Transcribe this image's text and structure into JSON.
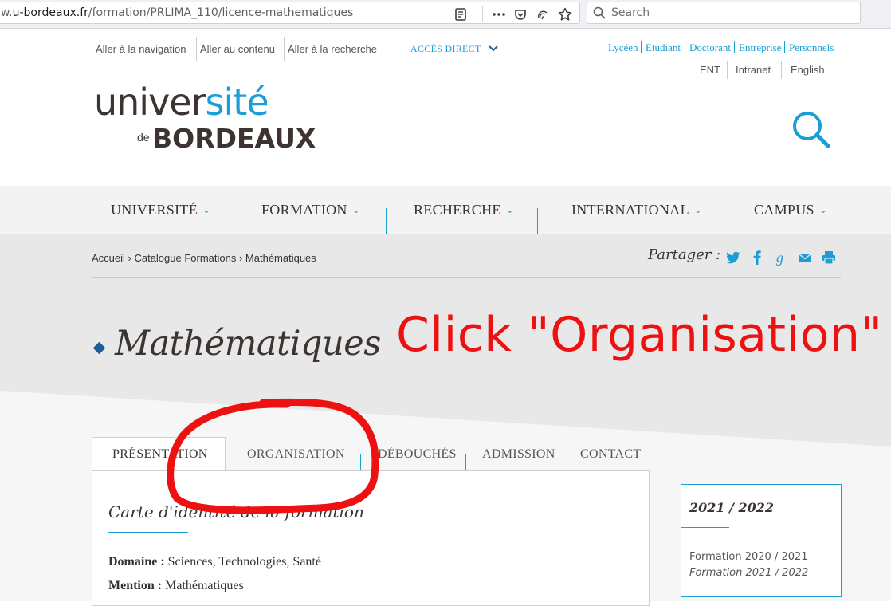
{
  "browser": {
    "url_prefix": "w.",
    "url_host": "u-bordeaux.fr",
    "url_path": "/formation/PRLIMA_110/licence-mathematiques",
    "search_placeholder": "Search"
  },
  "skiplinks": [
    "Aller à la navigation",
    "Aller au contenu",
    "Aller à la recherche"
  ],
  "acces_direct": "ACCÈS DIRECT",
  "personas": [
    "Lycéen",
    "Etudiant",
    "Doctorant",
    "Entreprise",
    "Personnels"
  ],
  "toolinks": [
    "ENT",
    "Intranet",
    "English"
  ],
  "logo": {
    "part1": "univer",
    "part2": "sité",
    "de": "de",
    "bordeaux": "BORDEAUX"
  },
  "nav": [
    "UNIVERSITÉ",
    "FORMATION",
    "RECHERCHE",
    "INTERNATIONAL",
    "CAMPUS"
  ],
  "breadcrumb": "Accueil › Catalogue Formations › Mathématiques",
  "share_label": "Partager :",
  "title": "Mathématiques",
  "annotation": "Click \"Organisation\"",
  "tabs": [
    "PRÉSENTATION",
    "ORGANISATION",
    "DÉBOUCHÉS",
    "ADMISSION",
    "CONTACT"
  ],
  "card": {
    "title": "Carte d'identité de la formation",
    "domaine_label": "Domaine :",
    "domaine_value": "Sciences, Technologies, Santé",
    "mention_label": "Mention :",
    "mention_value": "Mathématiques"
  },
  "side": {
    "year": "2021 / 2022",
    "link1": "Formation 2020 / 2021",
    "link2": "Formation 2021 / 2022"
  },
  "colors": {
    "accent": "#1a9ed5",
    "annotation": "#ee1111",
    "text": "#3d3431"
  }
}
